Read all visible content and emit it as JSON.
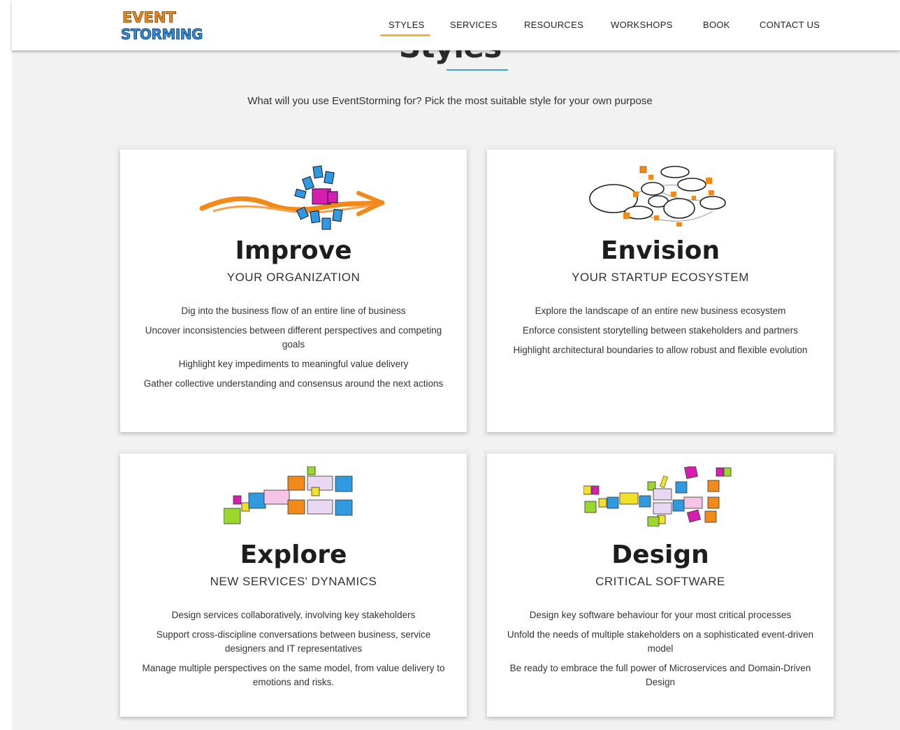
{
  "header": {
    "logo": {
      "line1": "EVENT",
      "line2": "STORMING"
    },
    "nav": [
      {
        "label": "STYLES",
        "active": true
      },
      {
        "label": "SERVICES"
      },
      {
        "label": "RESOURCES"
      },
      {
        "label": "WORKSHOPS"
      },
      {
        "label": "BOOK"
      },
      {
        "label": "CONTACT US"
      }
    ],
    "active_color": "#f2b233"
  },
  "section": {
    "title": "Styles",
    "subtitle": "What will you use EventStorming for? Pick the most suitable style for your own purpose",
    "underline_color": "#3ba3e4"
  },
  "cards": [
    {
      "title": "Improve",
      "subtitle": "YOUR ORGANIZATION",
      "icon": "orange-arrow-with-sticky-notes-icon",
      "items": [
        "Dig into the business flow of an entire line of business",
        "Uncover inconsistencies between different perspectives and competing goals",
        "Highlight key impediments to meaningful value delivery",
        "Gather collective understanding and consensus around the next actions"
      ]
    },
    {
      "title": "Envision",
      "subtitle": "YOUR STARTUP ECOSYSTEM",
      "icon": "ecosystem-bubbles-icon",
      "items": [
        "Explore the landscape of an entire new business ecosystem",
        "Enforce consistent storytelling between stakeholders and partners",
        "Highlight architectural boundaries to allow robust and flexible evolution"
      ]
    },
    {
      "title": "Explore",
      "subtitle": "NEW SERVICES' DYNAMICS",
      "icon": "sticky-notes-flow-icon",
      "items": [
        "Design services collaboratively, involving key stakeholders",
        "Support cross-discipline conversations between business, service designers and IT representatives",
        "Manage multiple perspectives on the same model, from value delivery to emotions and risks."
      ]
    },
    {
      "title": "Design",
      "subtitle": "CRITICAL SOFTWARE",
      "icon": "software-design-notes-icon",
      "items": [
        "Design key software behaviour for your most critical processes",
        "Unfold the needs of multiple stakeholders on a sophisticated event-driven model",
        "Be ready to embrace the full power of Microservices and Domain-Driven Design"
      ]
    }
  ]
}
